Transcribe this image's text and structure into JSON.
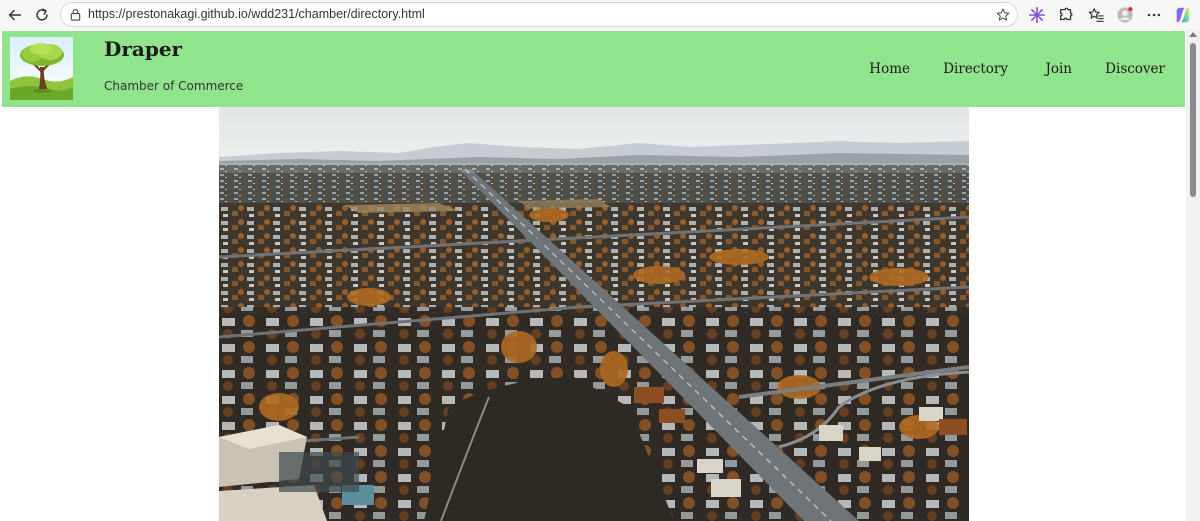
{
  "browser": {
    "url": "https://prestonakagi.github.io/wdd231/chamber/directory.html",
    "icons": [
      "back-icon",
      "reload-icon",
      "lock-icon",
      "star-icon",
      "copilot-sparkle-icon",
      "extensions-icon",
      "favorites-icon",
      "profile-icon",
      "more-icon",
      "copilot-icon"
    ]
  },
  "header": {
    "title": "Draper",
    "subtitle": "Chamber of Commerce",
    "background_color": "#90e48c"
  },
  "nav": {
    "items": [
      {
        "label": "Home"
      },
      {
        "label": "Directory"
      },
      {
        "label": "Join"
      },
      {
        "label": "Discover"
      }
    ]
  },
  "hero": {
    "subject": "aerial-photo-of-draper-town"
  }
}
